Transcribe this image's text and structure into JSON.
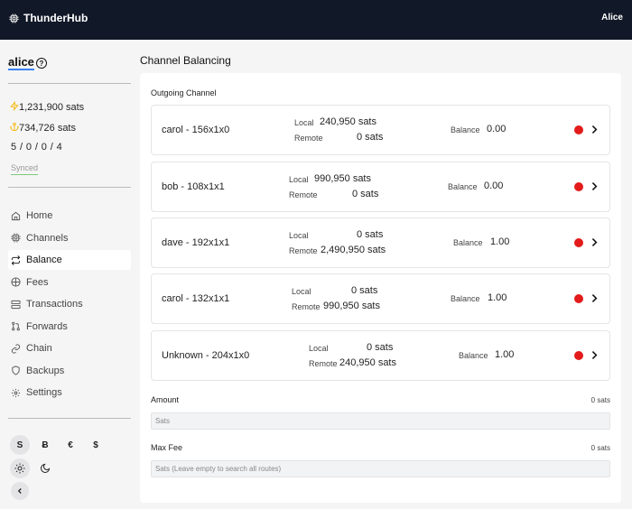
{
  "header": {
    "app_name": "ThunderHub",
    "user": "Alice"
  },
  "sidebar": {
    "alias": "alice",
    "help": "?",
    "lightning_balance": "1,231,900 sats",
    "chain_balance": "734,726 sats",
    "channel_counts": "5 / 0 / 0 / 4",
    "sync_status": "Synced",
    "nav": [
      {
        "label": "Home",
        "icon": "home-icon"
      },
      {
        "label": "Channels",
        "icon": "cpu-icon"
      },
      {
        "label": "Balance",
        "icon": "repeat-icon",
        "active": true
      },
      {
        "label": "Fees",
        "icon": "compass-icon"
      },
      {
        "label": "Transactions",
        "icon": "server-icon"
      },
      {
        "label": "Forwards",
        "icon": "git-pull-request-icon"
      },
      {
        "label": "Chain",
        "icon": "link-icon"
      },
      {
        "label": "Backups",
        "icon": "shield-icon"
      },
      {
        "label": "Settings",
        "icon": "settings-icon"
      }
    ],
    "currencies": [
      "S",
      "Ƀ",
      "€",
      "$"
    ],
    "selected_currency": "S"
  },
  "main": {
    "title": "Channel Balancing",
    "section": "Outgoing Channel",
    "local_label": "Local",
    "remote_label": "Remote",
    "balance_label": "Balance",
    "channels": [
      {
        "name": "carol - 156x1x0",
        "local": "240,950 sats",
        "remote": "0 sats",
        "balance": "0.00"
      },
      {
        "name": "bob - 108x1x1",
        "local": "990,950 sats",
        "remote": "0 sats",
        "balance": "0.00"
      },
      {
        "name": "dave - 192x1x1",
        "local": "0 sats",
        "remote": "2,490,950 sats",
        "balance": "1.00"
      },
      {
        "name": "carol - 132x1x1",
        "local": "0 sats",
        "remote": "990,950 sats",
        "balance": "1.00"
      },
      {
        "name": "Unknown - 204x1x0",
        "local": "0 sats",
        "remote": "240,950 sats",
        "balance": "1.00"
      }
    ],
    "amount_label": "Amount",
    "amount_value": "0 sats",
    "amount_placeholder": "Sats",
    "maxfee_label": "Max Fee",
    "maxfee_value": "0 sats",
    "maxfee_placeholder": "Sats (Leave empty to search all routes)"
  },
  "colors": {
    "header_bg": "#111827",
    "status_dot": "#e41b1b",
    "accent": "#3b82f6"
  }
}
